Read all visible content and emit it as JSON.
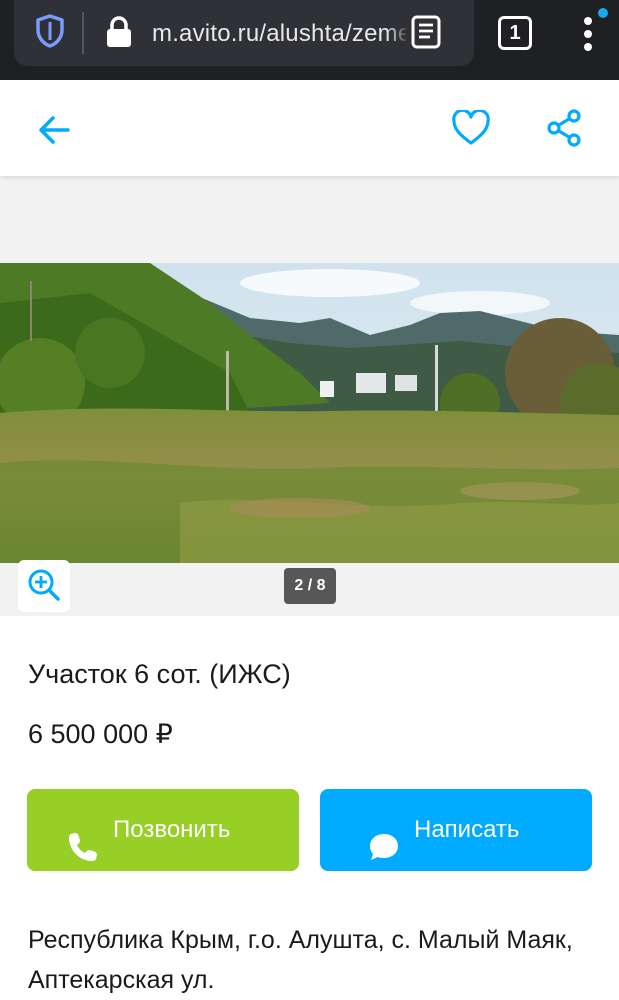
{
  "browser": {
    "url": "m.avito.ru/alushta/zemelnye_uchastki",
    "tab_count": "1",
    "colors": {
      "chrome_bg": "#1f2023",
      "urlbar_bg": "#2f3136",
      "shield": "#7b9cff",
      "notify_dot": "#1aa7ec"
    },
    "icons": [
      "shield-icon",
      "lock-icon",
      "reader-mode-icon",
      "tabs-counter",
      "more-vertical-icon"
    ]
  },
  "header": {
    "icons": [
      "arrow-left-icon",
      "heart-outline-icon",
      "share-icon"
    ],
    "accent_color": "#00aaff"
  },
  "gallery": {
    "counter": "2 / 8",
    "icons": [
      "zoom-in-icon"
    ],
    "photo_subject": "land plot"
  },
  "listing": {
    "title": "Участок 6 сот. (ИЖС)",
    "price": "6 500 000 ₽",
    "call_label": "Позвонить",
    "write_label": "Написать",
    "call_color": "#97cf26",
    "write_color": "#00aaff",
    "address": "Республика Крым, г.о. Алушта, с. Малый Маяк, Аптекарская ул."
  }
}
